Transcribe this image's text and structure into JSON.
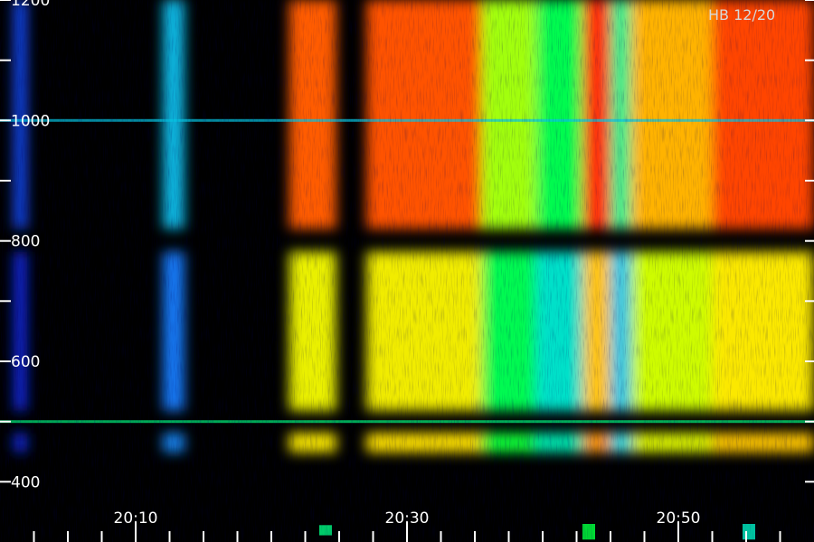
{
  "chart_data": {
    "type": "heatmap",
    "title": "",
    "xlabel": "",
    "ylabel": "",
    "corner_label": "HB 12/20",
    "xlim": [
      "20:00",
      "21:00"
    ],
    "ylim": [
      300,
      1200
    ],
    "y_major_ticks": [
      {
        "value": 400,
        "label": "400"
      },
      {
        "value": 500,
        "label": ""
      },
      {
        "value": 600,
        "label": "600"
      },
      {
        "value": 700,
        "label": ""
      },
      {
        "value": 800,
        "label": "800"
      },
      {
        "value": 900,
        "label": ""
      },
      {
        "value": 1000,
        "label": "1000"
      },
      {
        "value": 1100,
        "label": ""
      },
      {
        "value": 1200,
        "label": "1200"
      }
    ],
    "x_major_ticks": [
      {
        "value": "20:10",
        "label": "20:10"
      },
      {
        "value": "20:30",
        "label": "20:30"
      },
      {
        "value": "20:50",
        "label": "20:50"
      }
    ],
    "x_minor_tick_interval_minutes": 2.5,
    "colormap": [
      "#000000",
      "#0000c8",
      "#1e64ff",
      "#00dcdc",
      "#00ff3c",
      "#c8ff00",
      "#ffe600",
      "#ff5a00",
      "#ff1e00"
    ],
    "intensity_scale": [
      0,
      1
    ],
    "time_bands": [
      {
        "start": "20:01",
        "end": "20:02",
        "intensity": 0.22
      },
      {
        "start": "20:12",
        "end": "20:13.6",
        "intensity": 0.35
      },
      {
        "start": "20:21.3",
        "end": "20:24.8",
        "intensity": 0.9
      },
      {
        "start": "20:27",
        "end": "20:35.5",
        "intensity": 0.92
      },
      {
        "start": "20:35.5",
        "end": "20:39.5",
        "intensity": 0.62
      },
      {
        "start": "20:39.5",
        "end": "20:43",
        "intensity": 0.5
      },
      {
        "start": "20:43",
        "end": "20:45",
        "intensity": 1.0
      },
      {
        "start": "20:45",
        "end": "20:46.5",
        "intensity": 0.45
      },
      {
        "start": "20:46.5",
        "end": "20:52.5",
        "intensity": 0.82
      },
      {
        "start": "20:52.5",
        "end": "21:00",
        "intensity": 0.95
      }
    ],
    "frequency_bands": [
      {
        "low": 449,
        "high": 481,
        "intensity": 0.82
      },
      {
        "low": 518,
        "high": 782,
        "intensity": 0.78
      },
      {
        "low": 820,
        "high": 1200,
        "intensity": 0.97
      }
    ],
    "vertical_streaks": [
      {
        "time": "20:24",
        "low": 311,
        "high": 328,
        "intensity": 0.45
      },
      {
        "time": "20:43.4",
        "low": 304,
        "high": 330,
        "intensity": 0.5
      },
      {
        "time": "20:55.2",
        "low": 304,
        "high": 330,
        "intensity": 0.4
      }
    ],
    "horizontal_lines": [
      {
        "value": 500,
        "intensity": 0.45
      },
      {
        "value": 1000,
        "intensity": 0.35
      }
    ]
  }
}
